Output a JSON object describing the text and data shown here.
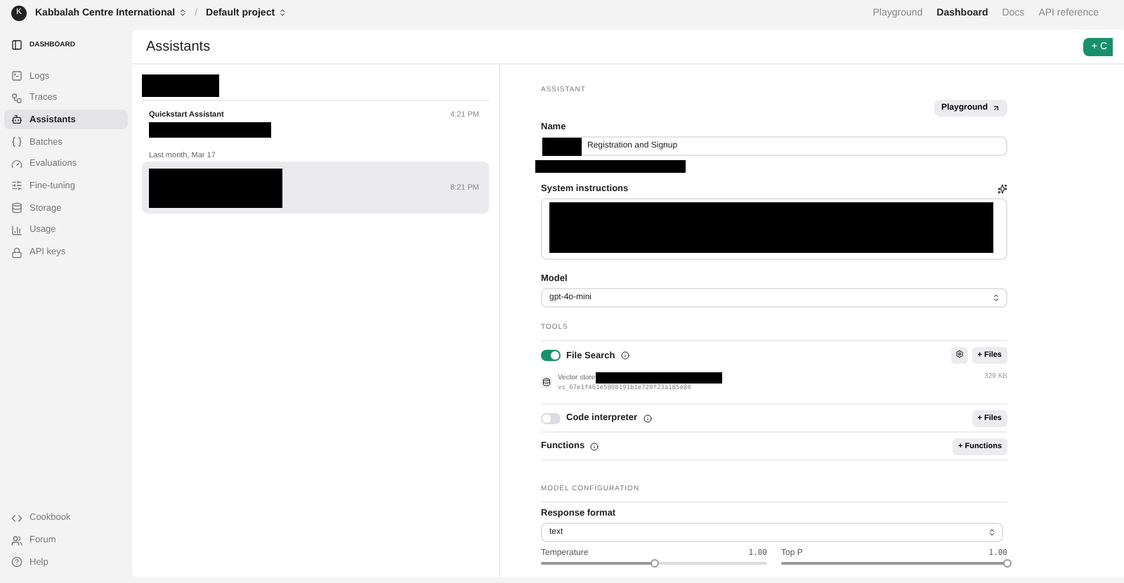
{
  "topbar": {
    "avatar": "K",
    "org": "Kabbalah Centre International",
    "separator": "/",
    "project": "Default project",
    "nav": [
      {
        "label": "Playground",
        "selected": false
      },
      {
        "label": "Dashboard",
        "selected": true
      },
      {
        "label": "Docs",
        "selected": false
      },
      {
        "label": "API reference",
        "selected": false
      }
    ]
  },
  "sidebar": {
    "heading": "DASHBOARD",
    "items": [
      {
        "label": "Logs",
        "selected": false
      },
      {
        "label": "Traces",
        "selected": false
      },
      {
        "label": "Assistants",
        "selected": true
      },
      {
        "label": "Batches",
        "selected": false
      },
      {
        "label": "Evaluations",
        "selected": false
      },
      {
        "label": "Fine-tuning",
        "selected": false
      },
      {
        "label": "Storage",
        "selected": false
      },
      {
        "label": "Usage",
        "selected": false
      },
      {
        "label": "API keys",
        "selected": false
      }
    ],
    "footer": [
      {
        "label": "Cookbook"
      },
      {
        "label": "Forum"
      },
      {
        "label": "Help"
      }
    ]
  },
  "header": {
    "title": "Assistants",
    "create_button": "+ C"
  },
  "assistant_list": [
    {
      "kind": "item",
      "name": "Quickstart Assistant",
      "time": "4:21 PM",
      "selected": false
    },
    {
      "kind": "heading",
      "label": "Last month, Mar 17"
    },
    {
      "kind": "item",
      "time": "8:21 PM",
      "selected": true
    }
  ],
  "assistant": {
    "section": "ASSISTANT",
    "playground_button": "Playground",
    "name_label": "Name",
    "name_value": "Registration and Signup",
    "instructions_label": "System instructions",
    "model_label": "Model",
    "model_value": "gpt-4o-mini",
    "tools_heading": "TOOLS",
    "tools": [
      {
        "kind": "file_search",
        "label": "File Search",
        "on": true,
        "files_button": "+ Files",
        "vector_store": {
          "label": "Vector store",
          "id": "vs_67e1f461e5808191b1e720f23a185e84",
          "size": "329 KB"
        }
      },
      {
        "kind": "code_interpreter",
        "label": "Code interpreter",
        "on": false,
        "files_button": "+ Files"
      },
      {
        "kind": "functions",
        "label": "Functions",
        "button": "+ Functions"
      }
    ],
    "config_heading": "MODEL CONFIGURATION",
    "response_format_label": "Response format",
    "response_format_value": "text",
    "sliders": [
      {
        "label": "Temperature",
        "reading": "1.00",
        "level": 0.5
      },
      {
        "label": "Top P",
        "reading": "1.00",
        "level": 1.0
      }
    ]
  }
}
